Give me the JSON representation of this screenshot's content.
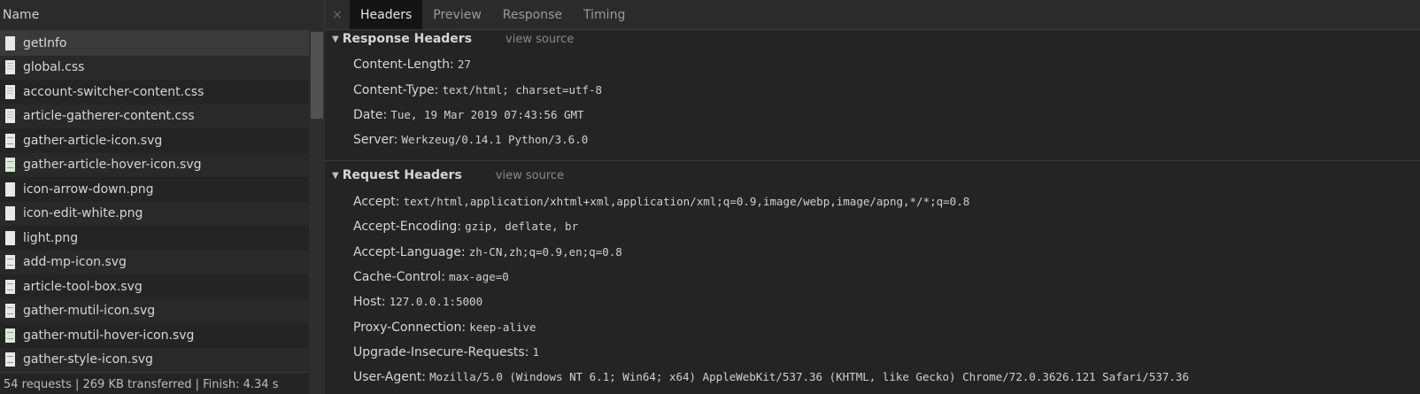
{
  "name_header": "Name",
  "files": [
    {
      "name": "getInfo",
      "icon": "document-icon",
      "kind": "doc"
    },
    {
      "name": "global.css",
      "icon": "css-file-icon",
      "kind": "css"
    },
    {
      "name": "account-switcher-content.css",
      "icon": "css-file-icon",
      "kind": "css"
    },
    {
      "name": "article-gatherer-content.css",
      "icon": "css-file-icon",
      "kind": "css"
    },
    {
      "name": "gather-article-icon.svg",
      "icon": "svg-file-icon",
      "kind": "svg"
    },
    {
      "name": "gather-article-hover-icon.svg",
      "icon": "svg-file-icon",
      "kind": "svg-green"
    },
    {
      "name": "icon-arrow-down.png",
      "icon": "image-file-icon",
      "kind": "doc"
    },
    {
      "name": "icon-edit-white.png",
      "icon": "image-file-icon",
      "kind": "doc"
    },
    {
      "name": "light.png",
      "icon": "image-file-icon",
      "kind": "doc"
    },
    {
      "name": "add-mp-icon.svg",
      "icon": "svg-file-icon",
      "kind": "svg"
    },
    {
      "name": "article-tool-box.svg",
      "icon": "svg-file-icon",
      "kind": "svg"
    },
    {
      "name": "gather-mutil-icon.svg",
      "icon": "svg-file-icon",
      "kind": "svg"
    },
    {
      "name": "gather-mutil-hover-icon.svg",
      "icon": "svg-file-icon",
      "kind": "svg-green"
    },
    {
      "name": "gather-style-icon.svg",
      "icon": "svg-file-icon",
      "kind": "svg"
    }
  ],
  "status_bar": "54 requests | 269 KB transferred | Finish: 4.34 s",
  "tabs": {
    "close": "×",
    "headers": "Headers",
    "preview": "Preview",
    "response": "Response",
    "timing": "Timing"
  },
  "response_headers": {
    "title": "Response Headers",
    "view_source": "view source",
    "items": [
      {
        "key": "Content-Length:",
        "value": "27"
      },
      {
        "key": "Content-Type:",
        "value": "text/html; charset=utf-8"
      },
      {
        "key": "Date:",
        "value": "Tue, 19 Mar 2019 07:43:56 GMT"
      },
      {
        "key": "Server:",
        "value": "Werkzeug/0.14.1 Python/3.6.0"
      }
    ]
  },
  "request_headers": {
    "title": "Request Headers",
    "view_source": "view source",
    "items": [
      {
        "key": "Accept:",
        "value": "text/html,application/xhtml+xml,application/xml;q=0.9,image/webp,image/apng,*/*;q=0.8"
      },
      {
        "key": "Accept-Encoding:",
        "value": "gzip, deflate, br"
      },
      {
        "key": "Accept-Language:",
        "value": "zh-CN,zh;q=0.9,en;q=0.8"
      },
      {
        "key": "Cache-Control:",
        "value": "max-age=0"
      },
      {
        "key": "Host:",
        "value": "127.0.0.1:5000"
      },
      {
        "key": "Proxy-Connection:",
        "value": "keep-alive"
      },
      {
        "key": "Upgrade-Insecure-Requests:",
        "value": "1"
      },
      {
        "key": "User-Agent:",
        "value": "Mozilla/5.0 (Windows NT 6.1; Win64; x64) AppleWebKit/537.36 (KHTML, like Gecko) Chrome/72.0.3626.121 Safari/537.36"
      }
    ]
  }
}
